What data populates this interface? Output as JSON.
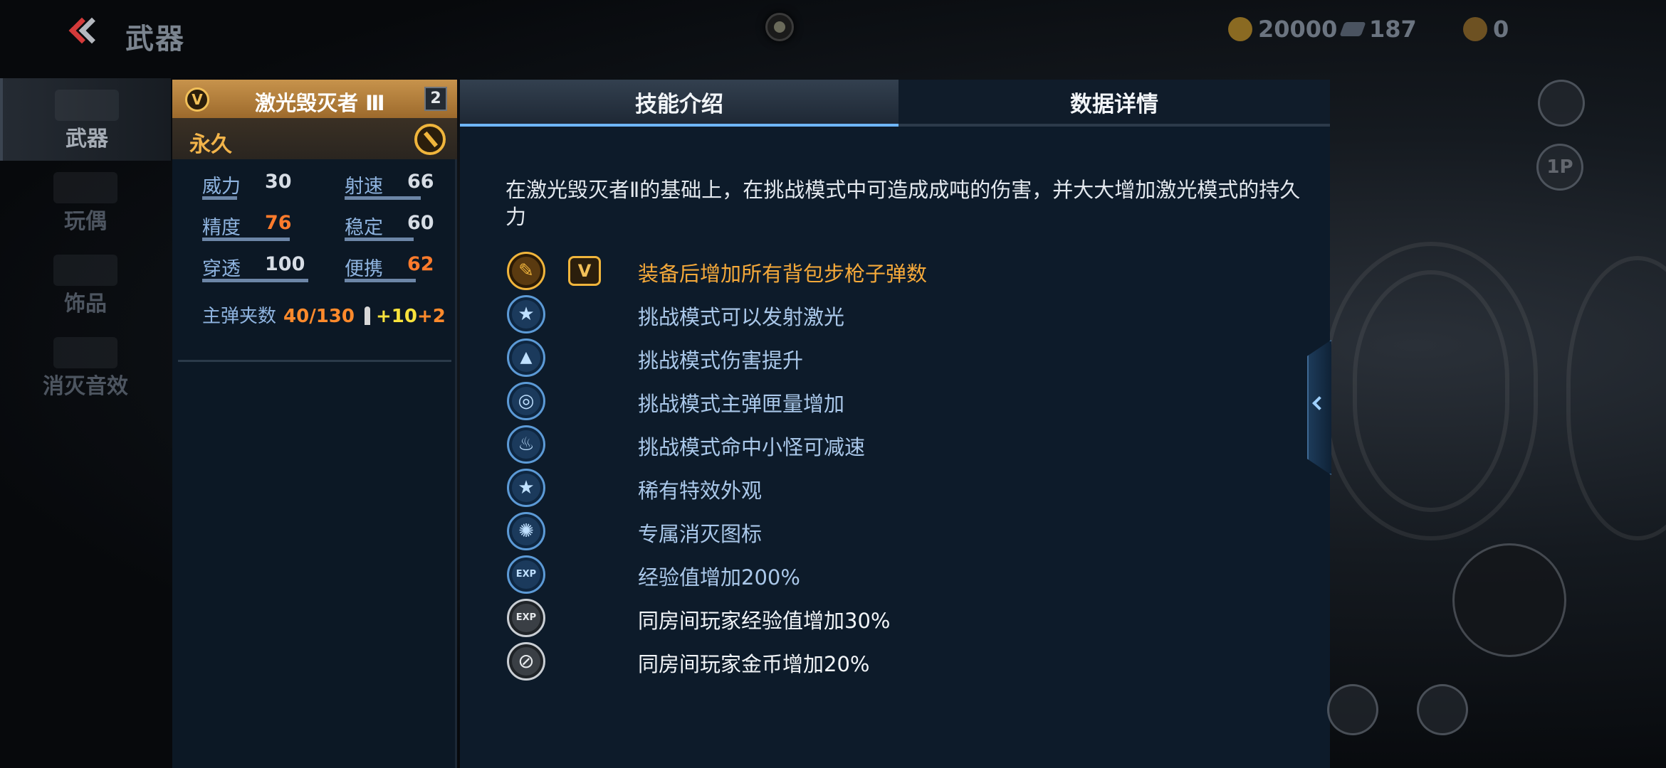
{
  "header": {
    "title": "武器",
    "currency": {
      "gold": "20000",
      "gems": "187",
      "medals": "0"
    }
  },
  "categories": [
    {
      "label": "武器",
      "icon": "rifle-icon",
      "active": true
    },
    {
      "label": "玩偶",
      "icon": "doll-icon",
      "active": false
    },
    {
      "label": "饰品",
      "icon": "accessory-icon",
      "active": false
    },
    {
      "label": "消灭音效",
      "icon": "speaker-icon",
      "active": false
    }
  ],
  "weapon": {
    "name": "激光毁灭者 Ⅲ",
    "level": "2",
    "rank": "V",
    "duration": "永久",
    "stats": [
      {
        "label": "威力",
        "value": "30",
        "highlight": false,
        "fill": 0.3
      },
      {
        "label": "射速",
        "value": "66",
        "highlight": false,
        "fill": 0.66
      },
      {
        "label": "精度",
        "value": "76",
        "highlight": true,
        "fill": 0.76
      },
      {
        "label": "稳定",
        "value": "60",
        "highlight": false,
        "fill": 0.6
      },
      {
        "label": "穿透",
        "value": "100",
        "highlight": false,
        "fill": 1.0
      },
      {
        "label": "便携",
        "value": "62",
        "highlight": true,
        "fill": 0.62
      }
    ],
    "clip": {
      "label": "主弹夹数",
      "value": "40/130",
      "bonus1": "+10",
      "bonus2": "+2"
    }
  },
  "tabs": {
    "skills": "技能介绍",
    "details": "数据详情",
    "active": "skills"
  },
  "skill_panel": {
    "description": "在激光毁灭者Ⅱ的基础上，在挑战模式中可造成成吨的伤害，并大大增加激光模式的持久力",
    "skills": [
      {
        "text": "装备后增加所有背包步枪子弹数",
        "icon": "rifle-ammo-icon",
        "style": "gold",
        "rank_badge": "V"
      },
      {
        "text": "挑战模式可以发射激光",
        "icon": "star-icon",
        "style": "blue"
      },
      {
        "text": "挑战模式伤害提升",
        "icon": "damage-up-icon",
        "style": "blue"
      },
      {
        "text": "挑战模式主弹匣量增加",
        "icon": "crosshair-icon",
        "style": "blue"
      },
      {
        "text": "挑战模式命中小怪可减速",
        "icon": "slow-icon",
        "style": "blue"
      },
      {
        "text": "稀有特效外观",
        "icon": "star-icon",
        "style": "blue"
      },
      {
        "text": "专属消灭图标",
        "icon": "kill-icon",
        "style": "blue"
      },
      {
        "text": "经验值增加200%",
        "icon": "exp-icon",
        "style": "blue"
      },
      {
        "text": "同房间玩家经验值增加30%",
        "icon": "exp-icon",
        "style": "white"
      },
      {
        "text": "同房间玩家金币增加20%",
        "icon": "coin-icon",
        "style": "white"
      }
    ]
  },
  "hud": {
    "view_mode": "1P"
  }
}
